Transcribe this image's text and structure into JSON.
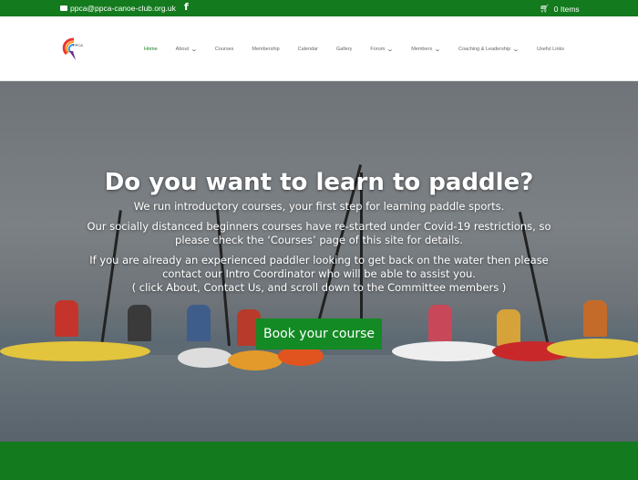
{
  "topbar": {
    "email": "ppca@ppca-canoe-club.org.uk",
    "facebook": "f",
    "cart": "0 Items"
  },
  "logo_text": "PPCA",
  "nav": [
    {
      "label": "Home",
      "active": true,
      "dropdown": false
    },
    {
      "label": "About",
      "dropdown": true
    },
    {
      "label": "Courses",
      "dropdown": false
    },
    {
      "label": "Membership",
      "dropdown": false
    },
    {
      "label": "Calendar",
      "dropdown": false
    },
    {
      "label": "Gallery",
      "dropdown": false
    },
    {
      "label": "Forum",
      "dropdown": true
    },
    {
      "label": "Members",
      "dropdown": true
    },
    {
      "label": "Coaching & Leadership",
      "dropdown": true
    },
    {
      "label": "Useful Links",
      "dropdown": false
    }
  ],
  "hero": {
    "title": "Do you want to learn to paddle?",
    "p1": "We run introductory courses, your first step for learning paddle sports.",
    "p2": "Our socially distanced beginners courses have re-started under Covid-19 restrictions, so please check the ‘Courses’ page of this site for details.",
    "p3a": "If you are already an experienced paddler looking to get back on the water then please contact our Intro Coordinator who will be able to assist you.",
    "p3b": "( click About, Contact Us, and scroll down to the Committee members )",
    "cta": "Book your course"
  },
  "colors": {
    "brand_green": "#137a1e",
    "button_green": "#138a24"
  }
}
